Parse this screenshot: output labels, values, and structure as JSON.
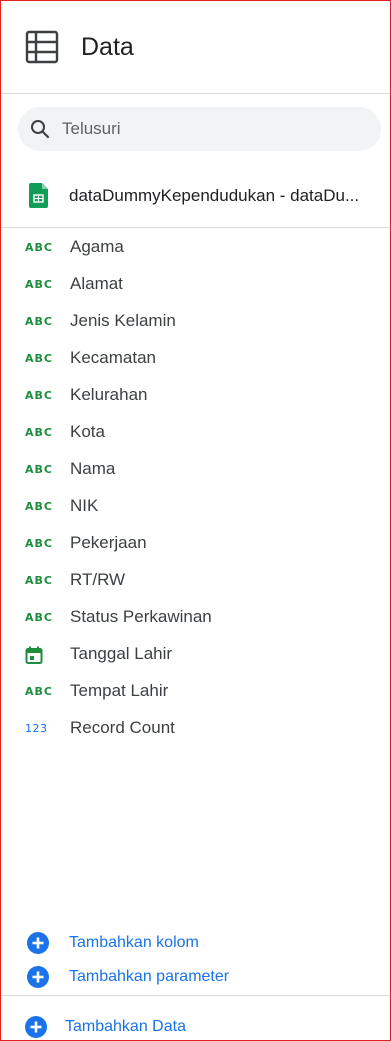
{
  "header": {
    "title": "Data",
    "icon": "data-table-icon"
  },
  "search": {
    "placeholder": "Telusuri",
    "value": ""
  },
  "data_source": {
    "name": "dataDummyKependudukan - dataDu...",
    "icon": "google-sheets-icon"
  },
  "fields": [
    {
      "type": "text",
      "type_label": "ABC",
      "name": "Agama"
    },
    {
      "type": "text",
      "type_label": "ABC",
      "name": "Alamat"
    },
    {
      "type": "text",
      "type_label": "ABC",
      "name": "Jenis Kelamin"
    },
    {
      "type": "text",
      "type_label": "ABC",
      "name": "Kecamatan"
    },
    {
      "type": "text",
      "type_label": "ABC",
      "name": "Kelurahan"
    },
    {
      "type": "text",
      "type_label": "ABC",
      "name": "Kota"
    },
    {
      "type": "text",
      "type_label": "ABC",
      "name": "Nama"
    },
    {
      "type": "text",
      "type_label": "ABC",
      "name": "NIK"
    },
    {
      "type": "text",
      "type_label": "ABC",
      "name": "Pekerjaan"
    },
    {
      "type": "text",
      "type_label": "ABC",
      "name": "RT/RW"
    },
    {
      "type": "text",
      "type_label": "ABC",
      "name": "Status Perkawinan"
    },
    {
      "type": "date",
      "type_label": "",
      "name": "Tanggal Lahir"
    },
    {
      "type": "text",
      "type_label": "ABC",
      "name": "Tempat Lahir"
    },
    {
      "type": "number",
      "type_label": "123",
      "name": "Record Count"
    }
  ],
  "actions": {
    "add_column": "Tambahkan kolom",
    "add_parameter": "Tambahkan parameter",
    "add_data": "Tambahkan Data"
  },
  "colors": {
    "text_field": "#1e8e3e",
    "number_field": "#1a73e8",
    "link": "#1a73e8",
    "frame_border": "#e0211e"
  }
}
